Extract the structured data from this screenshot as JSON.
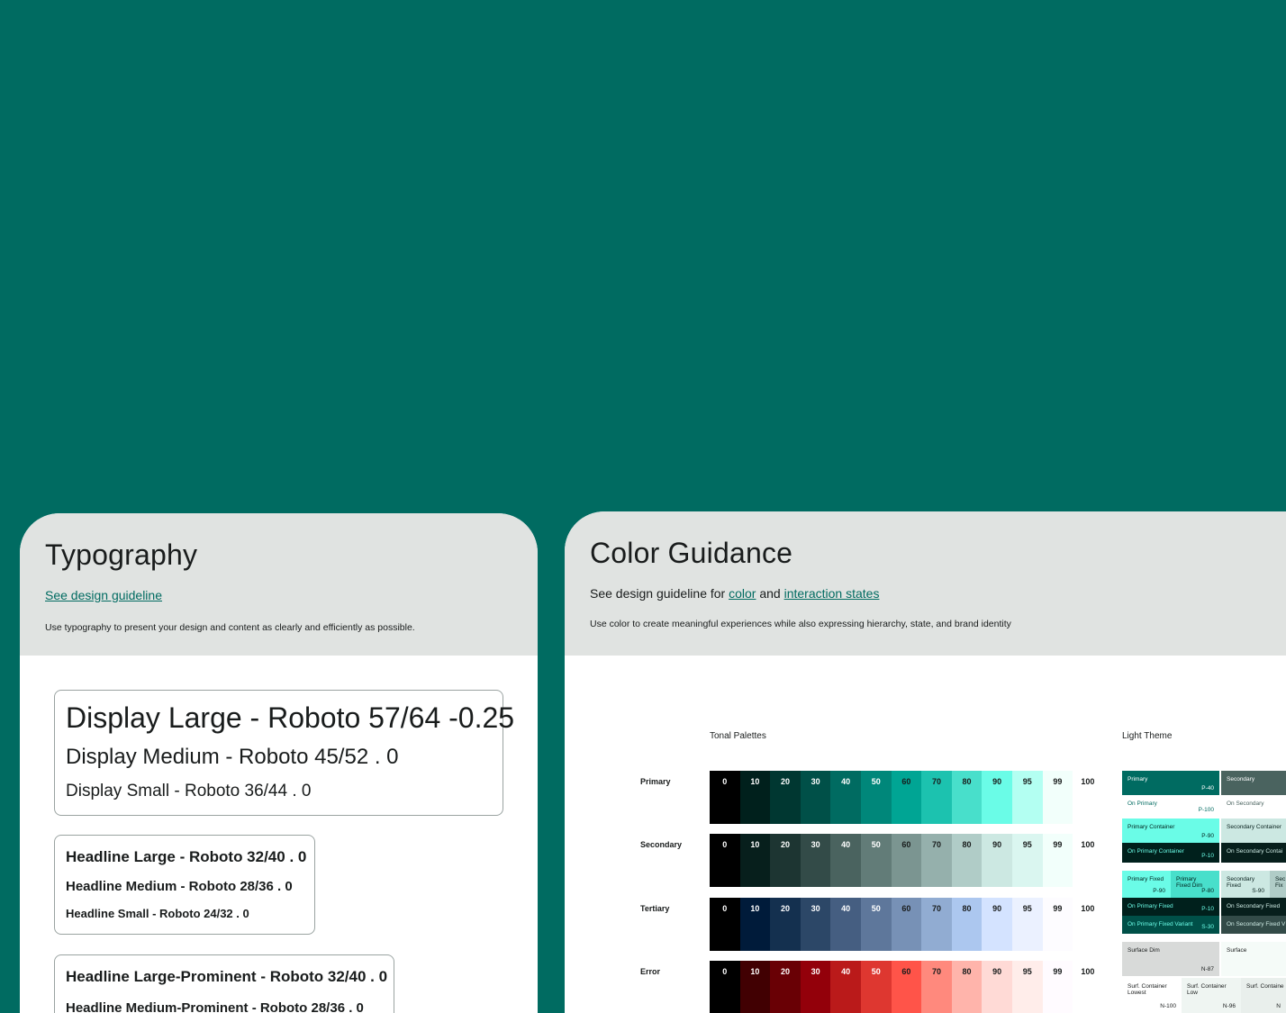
{
  "typography": {
    "title": "Typography",
    "link": "See design guideline",
    "desc": "Use typography to present your design and content as clearly and efficiently as possible.",
    "display_large": "Display Large - Roboto 57/64 -0.25",
    "display_medium": "Display Medium - Roboto 45/52 .  0",
    "display_small": "Display Small - Roboto 36/44 . 0",
    "headline_large": "Headline Large - Roboto 32/40 . 0",
    "headline_medium": "Headline Medium - Roboto 28/36 . 0",
    "headline_small": "Headline Small - Roboto 24/32 . 0",
    "prominent_large": "Headline Large-Prominent - Roboto 32/40 . 0",
    "prominent_medium": "Headline Medium-Prominent - Roboto 28/36 . 0"
  },
  "color": {
    "title": "Color Guidance",
    "line_prefix": "See design guideline for ",
    "link_color": "color",
    "line_mid": " and ",
    "link_states": "interaction states",
    "desc": "Use color to create meaningful experiences while also expressing hierarchy, state, and brand identity",
    "tonal_label": "Tonal Palettes",
    "light_label": "Light Theme",
    "tones": [
      "0",
      "10",
      "20",
      "30",
      "40",
      "50",
      "60",
      "70",
      "80",
      "90",
      "95",
      "99",
      "100"
    ],
    "palettes": [
      {
        "name": "Primary",
        "colors": [
          "#000000",
          "#00201c",
          "#003731",
          "#005048",
          "#006b61",
          "#00877a",
          "#00a594",
          "#1cc2af",
          "#48dfcb",
          "#6afce7",
          "#b3fff2",
          "#f2fffb",
          "#ffffff"
        ]
      },
      {
        "name": "Secondary",
        "colors": [
          "#000000",
          "#071f1c",
          "#1d3532",
          "#334b48",
          "#4a635f",
          "#627c78",
          "#7b9591",
          "#95b0ac",
          "#b0ccc7",
          "#cce8e2",
          "#daf6f0",
          "#f2fffb",
          "#ffffff"
        ]
      },
      {
        "name": "Tertiary",
        "colors": [
          "#000000",
          "#001b3a",
          "#14304f",
          "#2c4767",
          "#455e81",
          "#5e779b",
          "#7791b6",
          "#91acd2",
          "#acc7ef",
          "#d4e3ff",
          "#ebf1ff",
          "#fdfcff",
          "#ffffff"
        ]
      },
      {
        "name": "Error",
        "colors": [
          "#000000",
          "#410002",
          "#690005",
          "#93000a",
          "#ba1a1a",
          "#de3730",
          "#ff5449",
          "#ff897d",
          "#ffb4ab",
          "#ffdad6",
          "#ffedea",
          "#fffbff",
          "#ffffff"
        ]
      }
    ],
    "light_theme": {
      "primary": "Primary",
      "primary_val": "P-40",
      "on_primary": "On Primary",
      "on_primary_val": "P-100",
      "secondary": "Secondary",
      "on_secondary": "On Secondary",
      "primary_container": "Primary Container",
      "primary_container_val": "P-90",
      "on_primary_container": "On Primary Container",
      "on_primary_container_val": "P-10",
      "secondary_container": "Secondary Container",
      "on_secondary_container": "On Secondary Contai",
      "primary_fixed": "Primary Fixed",
      "primary_fixed_val": "P-90",
      "primary_fixed_dim": "Primary Fixed Dim",
      "primary_fixed_dim_val": "P-80",
      "secondary_fixed": "Secondary Fixed",
      "secondary_fixed_val": "S-90",
      "secondary_fixed_dim": "Sec Fix",
      "on_primary_fixed": "On Primary Fixed",
      "on_primary_fixed_val": "P-10",
      "on_secondary_fixed": "On Secondary Fixed",
      "on_primary_fixed_variant": "On Primary Fixed Variant",
      "on_primary_fixed_variant_val": "S-30",
      "on_secondary_fixed_variant": "On Secondary Fixed V",
      "surface_dim": "Surface Dim",
      "surface_dim_val": "N-87",
      "surface": "Surface",
      "surf_lowest": "Surf. Container Lowest",
      "surf_lowest_val": "N-100",
      "surf_low": "Surf. Container Low",
      "surf_low_val": "N-96",
      "surf_container": "Surf. Containe",
      "surf_container_val": "N"
    }
  }
}
